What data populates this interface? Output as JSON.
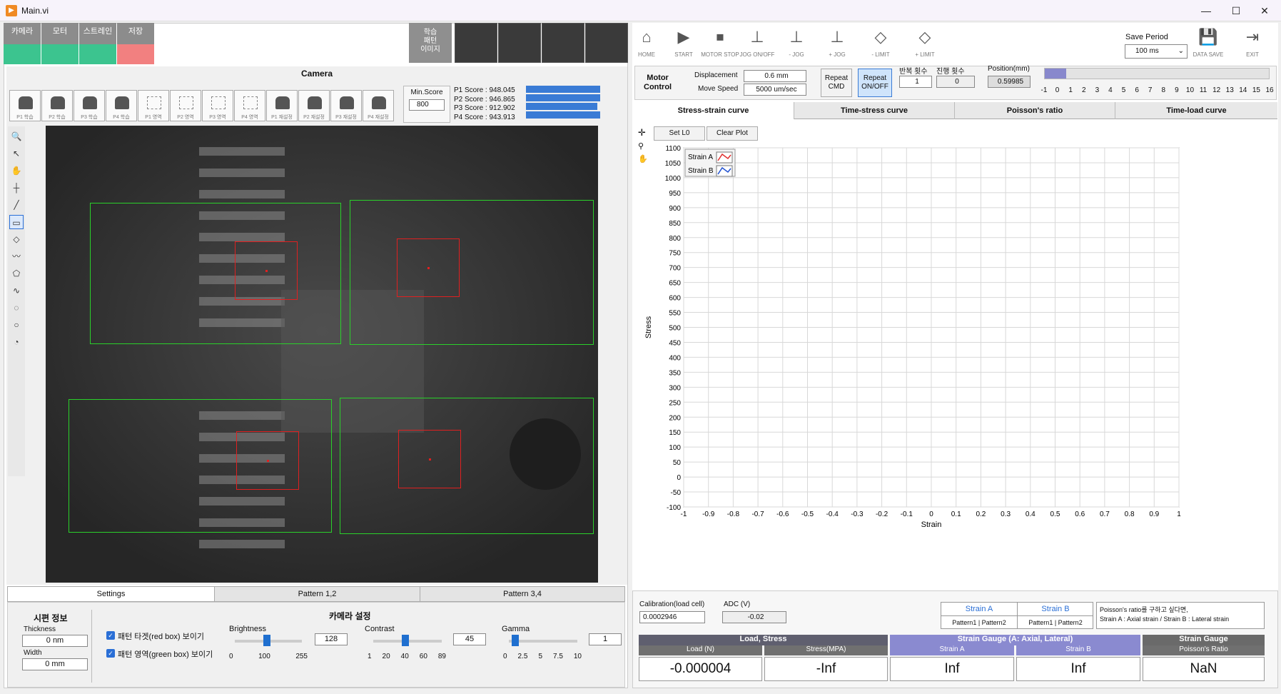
{
  "window": {
    "title": "Main.vi",
    "minimize": "—",
    "maximize": "☐",
    "close": "✕"
  },
  "top_buttons": [
    {
      "label": "카메라",
      "indicator": "#3cc48f"
    },
    {
      "label": "모터",
      "indicator": "#3cc48f"
    },
    {
      "label": "스트레인",
      "indicator": "#3cc48f"
    },
    {
      "label": "저장",
      "indicator": "#f28080"
    }
  ],
  "train_pattern_image": "학습\n패턴\n이미지",
  "camera": {
    "title": "Camera",
    "pattern_buttons": [
      "P1 학습",
      "P2 학습",
      "P3 학습",
      "P4 학습",
      "P1 영역",
      "P2 영역",
      "P3 영역",
      "P4 영역",
      "P1 재설정",
      "P2 재설정",
      "P3 재설정",
      "P4 재설정"
    ],
    "min_score_label": "Min.Score",
    "min_score": "800",
    "scores": [
      {
        "label": "P1 Score :",
        "value": "948.045",
        "fill": 0.948
      },
      {
        "label": "P2 Score :",
        "value": "946.865",
        "fill": 0.947
      },
      {
        "label": "P3 Score :",
        "value": "912.902",
        "fill": 0.913
      },
      {
        "label": "P4 Score :",
        "value": "943.913",
        "fill": 0.944
      }
    ]
  },
  "bottom_tabs": [
    "Settings",
    "Pattern 1,2",
    "Pattern 3,4"
  ],
  "specimen": {
    "title": "시편 정보",
    "thickness_label": "Thickness",
    "thickness": "0 nm",
    "width_label": "Width",
    "width": "0 mm"
  },
  "camera_settings": {
    "title": "카메라 설정",
    "show_red": "패턴 타겟(red box) 보이기",
    "show_green": "패턴 영역(green box) 보이기",
    "brightness": {
      "label": "Brightness",
      "value": "128",
      "ticks": [
        "0",
        "100",
        "255"
      ],
      "level": 0.5
    },
    "contrast": {
      "label": "Contrast",
      "value": "45",
      "ticks": [
        "1",
        "20",
        "40",
        "60",
        "89"
      ],
      "level": 0.5
    },
    "gamma": {
      "label": "Gamma",
      "value": "1",
      "ticks": [
        "0",
        "2.5",
        "5",
        "7.5",
        "10"
      ],
      "level": 0.1
    }
  },
  "toolbar": [
    {
      "label": "HOME",
      "icon": "home-icon"
    },
    {
      "label": "START",
      "icon": "start-icon"
    },
    {
      "label": "MOTOR STOP",
      "icon": "motor-stop-icon"
    },
    {
      "label": "JOG ON/OFF",
      "icon": "jog-onoff-icon"
    },
    {
      "label": "- JOG",
      "icon": "jog-minus-icon"
    },
    {
      "label": "+ JOG",
      "icon": "jog-plus-icon"
    },
    {
      "label": "- LIMIT",
      "icon": "limit-minus-icon"
    },
    {
      "label": "+ LIMIT",
      "icon": "limit-plus-icon"
    },
    {
      "label": "DATA SAVE",
      "icon": "save-icon"
    },
    {
      "label": "EXIT",
      "icon": "exit-icon"
    }
  ],
  "save_period": {
    "label": "Save Period",
    "value": "100 ms"
  },
  "motor": {
    "title": "Motor\nControl",
    "displacement_label": "Displacement",
    "displacement": "0.6 mm",
    "speed_label": "Move Speed",
    "speed": "5000 um/sec",
    "repeat_cmd": "Repeat\nCMD",
    "repeat_onoff": "Repeat\nON/OFF",
    "repeat_count_label": "반복 횟수",
    "repeat_count": "1",
    "progress_count_label": "진행 횟수",
    "progress_count": "0",
    "position_label": "Position(mm)",
    "position": "0.59985",
    "position_ticks": [
      "-1",
      "0",
      "1",
      "2",
      "3",
      "4",
      "5",
      "6",
      "7",
      "8",
      "9",
      "10",
      "11",
      "12",
      "13",
      "14",
      "15",
      "16"
    ],
    "position_level": 0.59985
  },
  "chart_tabs": [
    "Stress-strain curve",
    "Time-stress curve",
    "Poisson's ratio",
    "Time-load curve"
  ],
  "chart_buttons": {
    "set_l0": "Set L0",
    "clear": "Clear Plot"
  },
  "chart_data": {
    "type": "line",
    "xlabel": "Strain",
    "ylabel": "Stress",
    "xlim": [
      -1,
      1
    ],
    "ylim": [
      -100,
      1100
    ],
    "x_ticks": [
      "-1",
      "-0.9",
      "-0.8",
      "-0.7",
      "-0.6",
      "-0.5",
      "-0.4",
      "-0.3",
      "-0.2",
      "-0.1",
      "0",
      "0.1",
      "0.2",
      "0.3",
      "0.4",
      "0.5",
      "0.6",
      "0.7",
      "0.8",
      "0.9",
      "1"
    ],
    "y_ticks": [
      "1100",
      "1050",
      "1000",
      "950",
      "900",
      "850",
      "800",
      "750",
      "700",
      "650",
      "600",
      "550",
      "500",
      "450",
      "400",
      "350",
      "300",
      "250",
      "200",
      "150",
      "100",
      "50",
      "0",
      "-50",
      "-100"
    ],
    "grid": true,
    "legend_position": "top-left",
    "series": [
      {
        "name": "Strain A",
        "color": "#e03030",
        "values": []
      },
      {
        "name": "Strain B",
        "color": "#2050d0",
        "values": []
      }
    ]
  },
  "calibration": {
    "label": "Calibration(load cell)",
    "value": "0.0002946",
    "adc_label": "ADC (V)",
    "adc": "-0.02"
  },
  "strain_header": {
    "a": "Strain A",
    "b": "Strain B",
    "p1": "Pattern1",
    "p2": "Pattern2",
    "p1b": "Pattern1",
    "p2b": "Pattern2",
    "note1": "Poisson's ratio를 구하고 싶다면,",
    "note2": "Strain A : Axial strain / Strain B : Lateral strain"
  },
  "results": {
    "load_stress_title": "Load, Stress",
    "gauge_title": "Strain Gauge (A: Axial, Lateral)",
    "poisson_title": "Strain Gauge",
    "load_label": "Load (N)",
    "load": "-0.000004",
    "stress_label": "Stress(MPA)",
    "stress": "-Inf",
    "strain_a_label": "Strain A",
    "strain_a": "Inf",
    "strain_b_label": "Strain B",
    "strain_b": "Inf",
    "poisson_label": "Poisson's Ratio",
    "poisson": "NaN"
  }
}
